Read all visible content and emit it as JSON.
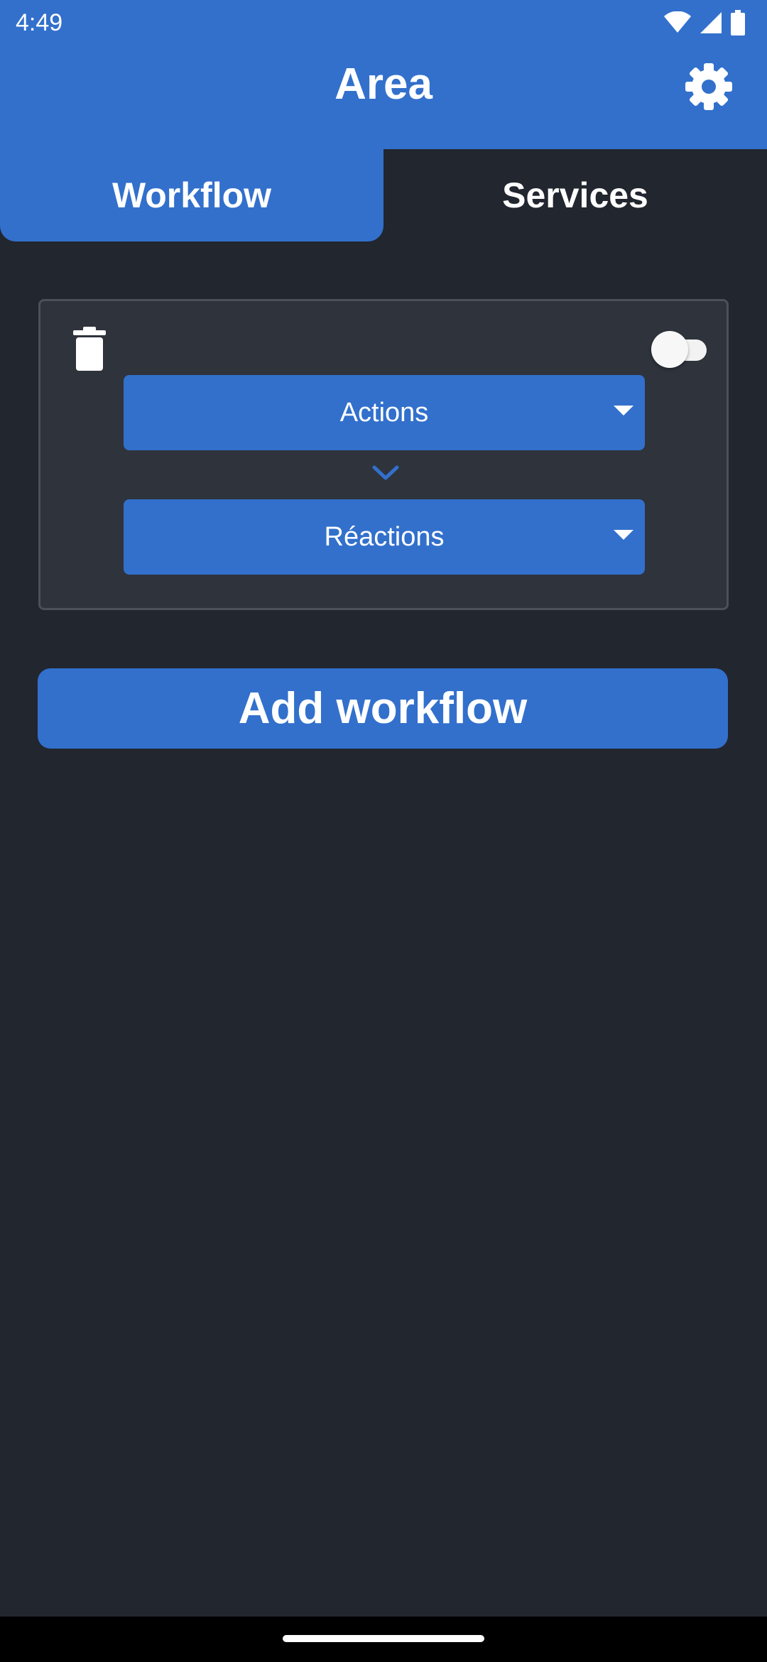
{
  "status_bar": {
    "time": "4:49",
    "icons": [
      "wifi-icon",
      "signal-icon",
      "battery-icon"
    ]
  },
  "app_bar": {
    "title": "Area",
    "settings_icon": "gear-icon"
  },
  "tabs": [
    {
      "label": "Workflow",
      "selected": true
    },
    {
      "label": "Services",
      "selected": false
    }
  ],
  "workflow_card": {
    "delete_icon": "trash-icon",
    "enabled": false,
    "actions_dropdown": {
      "label": "Actions"
    },
    "connector_icon": "chevron-down-icon",
    "reactions_dropdown": {
      "label": "Réactions"
    }
  },
  "add_workflow_button": {
    "label": "Add workflow"
  },
  "colors": {
    "primary": "#3270cc",
    "background": "#22262f",
    "card": "#2e333c",
    "card_border": "#4b5059",
    "text": "#ffffff"
  }
}
